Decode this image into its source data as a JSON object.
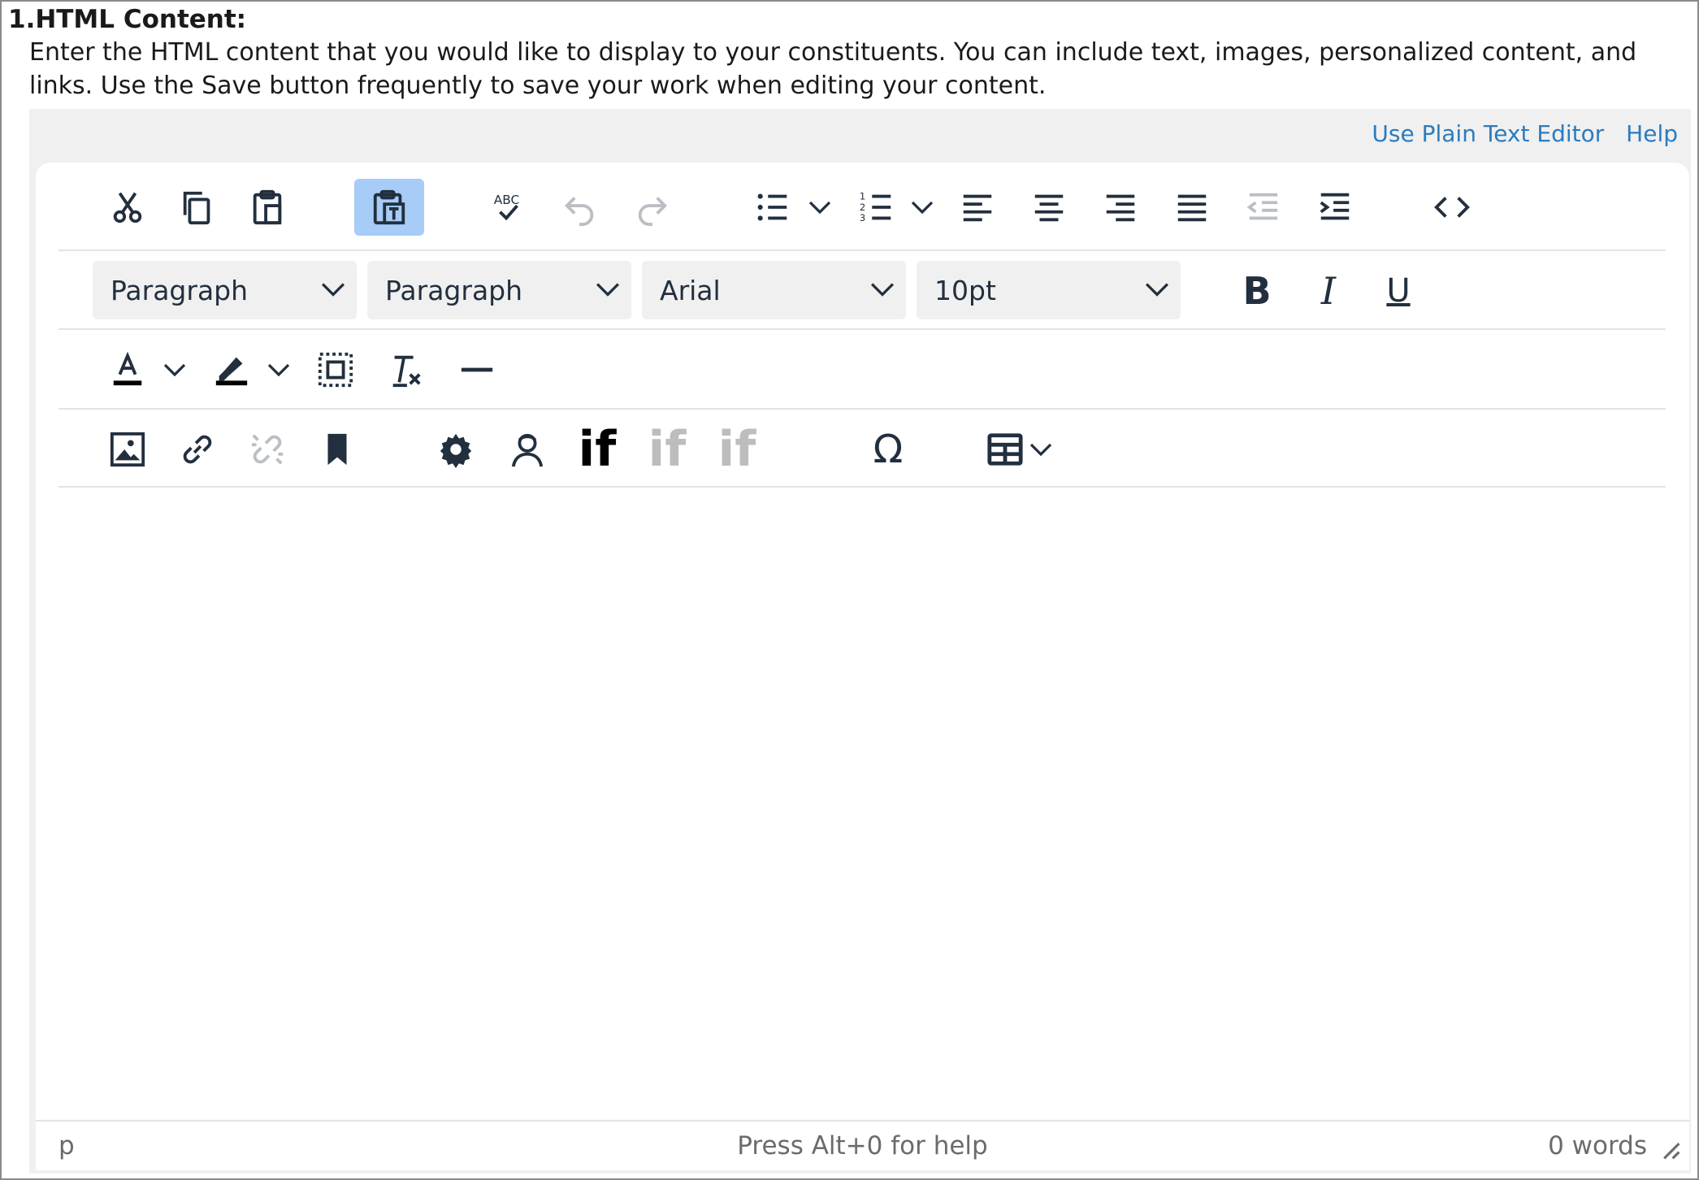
{
  "section": {
    "title": "1.HTML Content:",
    "instructions": "Enter the HTML content that you would like to display to your constituents. You can include text, images, personalized content, and links. Use the Save button frequently to save your work when editing your content."
  },
  "links": {
    "plain_text": "Use Plain Text Editor",
    "help": "Help"
  },
  "format": {
    "block_format": "Paragraph",
    "style": "Paragraph",
    "font_family": "Arial",
    "font_size": "10pt",
    "bold": "B",
    "italic": "I",
    "underline": "U"
  },
  "insert": {
    "if_label": "if",
    "omega": "Ω"
  },
  "status": {
    "path": "p",
    "help": "Press Alt+0 for help",
    "words": "0 words"
  },
  "colors": {
    "icon": "#222f3e",
    "disabled": "#c8c8c8",
    "active_bg": "#a6ccf7",
    "link": "#2b7bc0"
  }
}
